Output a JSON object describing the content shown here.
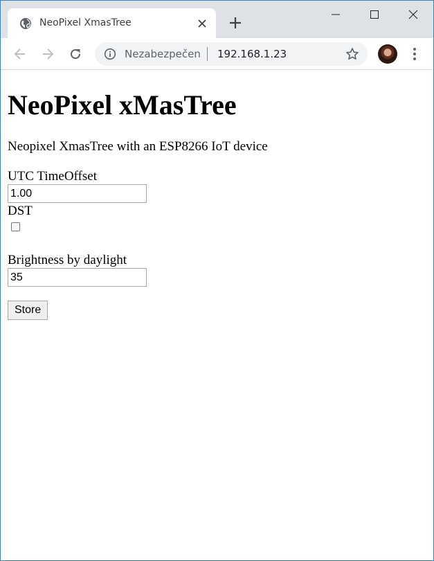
{
  "browser": {
    "tab_title": "NeoPixel XmasTree",
    "omnibox": {
      "security_label": "Nezabezpečen",
      "url": "192.168.1.23"
    }
  },
  "page": {
    "heading": "NeoPixel xMasTree",
    "description": "Neopixel XmasTree with an ESP8266 IoT device",
    "utc_offset": {
      "label": "UTC TimeOffset",
      "value": "1.00"
    },
    "dst": {
      "label": "DST",
      "checked": false
    },
    "brightness": {
      "label": "Brightness by daylight",
      "value": "35"
    },
    "store_label": "Store"
  },
  "colors": {
    "tabstrip": "#dee1e6",
    "omnibox_bg": "#f1f3f4",
    "window_border": "#3c7fb1"
  }
}
